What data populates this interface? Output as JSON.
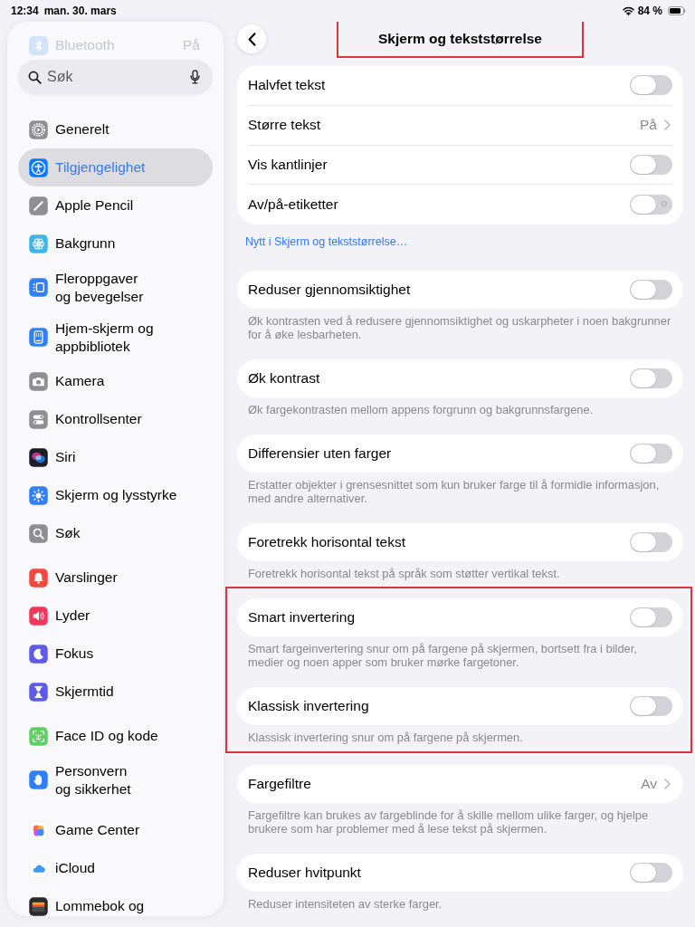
{
  "status_bar": {
    "time": "12:34",
    "date": "man. 30. mars",
    "battery": "84 %"
  },
  "sidebar": {
    "partly_hidden_item": {
      "label": "Bluetooth",
      "value": "På"
    },
    "search": {
      "placeholder": "Søk"
    },
    "groups": [
      {
        "items": [
          {
            "label": "Generelt",
            "selected": false
          },
          {
            "label": "Tilgjengelighet",
            "selected": true
          },
          {
            "label": "Apple Pencil",
            "selected": false
          },
          {
            "label": "Bakgrunn",
            "selected": false
          },
          {
            "label": "Fleroppgaver\nog bevegelser",
            "selected": false
          },
          {
            "label": "Hjem-skjerm og\nappbibliotek",
            "selected": false
          },
          {
            "label": "Kamera",
            "selected": false
          },
          {
            "label": "Kontrollsenter",
            "selected": false
          },
          {
            "label": "Siri",
            "selected": false
          },
          {
            "label": "Skjerm og lysstyrke",
            "selected": false
          },
          {
            "label": "Søk",
            "selected": false
          }
        ]
      },
      {
        "items": [
          {
            "label": "Varslinger",
            "selected": false
          },
          {
            "label": "Lyder",
            "selected": false
          },
          {
            "label": "Fokus",
            "selected": false
          },
          {
            "label": "Skjermtid",
            "selected": false
          }
        ]
      },
      {
        "items": [
          {
            "label": "Face ID og kode",
            "selected": false
          },
          {
            "label": "Personvern\nog sikkerhet",
            "selected": false
          }
        ]
      },
      {
        "items": [
          {
            "label": "Game Center",
            "selected": false
          },
          {
            "label": "iCloud",
            "selected": false
          },
          {
            "label": "Lommebok og",
            "selected": false
          }
        ]
      }
    ]
  },
  "header": {
    "title": "Skjerm og tekststørrelse",
    "highlighted": true
  },
  "sections": [
    {
      "highlighted": false,
      "rows": [
        {
          "kind": "toggle",
          "label": "Halvfet tekst",
          "on": false
        },
        {
          "kind": "link",
          "label": "Større tekst",
          "value": "På"
        },
        {
          "kind": "toggle",
          "label": "Vis kantlinjer",
          "on": false
        },
        {
          "kind": "labeled_toggle",
          "label": "Av/på-etiketter",
          "on": false
        }
      ],
      "link": "Nytt i Skjerm og tekststørrelse…"
    },
    {
      "highlighted": false,
      "rows": [
        {
          "kind": "toggle",
          "label": "Reduser gjennomsiktighet",
          "on": false
        }
      ],
      "footer": "Øk kontrasten ved å redusere gjennomsiktighet og uskarpheter i noen bakgrunner for å øke lesbarheten."
    },
    {
      "highlighted": false,
      "rows": [
        {
          "kind": "toggle",
          "label": "Øk kontrast",
          "on": false
        }
      ],
      "footer": "Øk fargekontrasten mellom appens forgrunn og bakgrunnsfargene."
    },
    {
      "highlighted": false,
      "rows": [
        {
          "kind": "toggle",
          "label": "Differensier uten farger",
          "on": false
        }
      ],
      "footer": "Erstatter objekter i grensesnittet som kun bruker farge til å formidle informasjon, med andre alternativer."
    },
    {
      "highlighted": false,
      "rows": [
        {
          "kind": "toggle",
          "label": "Foretrekk horisontal tekst",
          "on": false
        }
      ],
      "footer": "Foretrekk horisontal tekst på språk som støtter vertikal tekst."
    },
    {
      "highlighted": true,
      "rows": [
        {
          "kind": "toggle",
          "label": "Smart invertering",
          "on": false
        }
      ],
      "footer": "Smart fargeinvertering snur om på fargene på skjermen, bortsett fra i bilder, medier og noen apper som bruker mørke fargetoner."
    },
    {
      "highlighted": true,
      "rows": [
        {
          "kind": "toggle",
          "label": "Klassisk invertering",
          "on": false
        }
      ],
      "footer": "Klassisk invertering snur om på fargene på skjermen."
    },
    {
      "highlighted": false,
      "rows": [
        {
          "kind": "link",
          "label": "Fargefiltre",
          "value": "Av"
        }
      ],
      "footer": "Fargefiltre kan brukes av fargeblinde for å skille mellom ulike farger, og hjelpe brukere som har problemer med å lese tekst på skjermen."
    },
    {
      "highlighted": false,
      "rows": [
        {
          "kind": "toggle",
          "label": "Reduser hvitpunkt",
          "on": false
        }
      ],
      "footer": "Reduser intensiteten av sterke farger."
    }
  ]
}
